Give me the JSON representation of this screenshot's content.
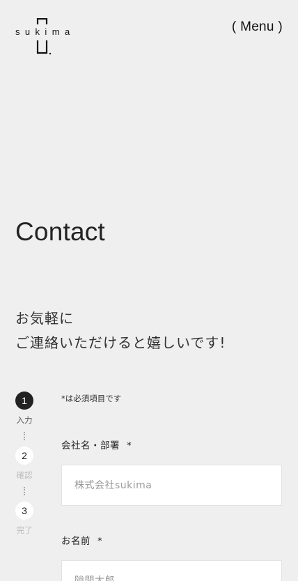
{
  "header": {
    "logo_text": "sukima",
    "menu_label": "( Menu )"
  },
  "page": {
    "title": "Contact",
    "lead_line1": "お気軽に",
    "lead_line2": "ご連絡いただけると嬉しいです!"
  },
  "stepper": {
    "steps": [
      {
        "number": "1",
        "label": "入力",
        "active": true
      },
      {
        "number": "2",
        "label": "確認",
        "active": false
      },
      {
        "number": "3",
        "label": "完了",
        "active": false
      }
    ]
  },
  "form": {
    "required_note": "*は必須項目です",
    "required_mark": "*",
    "company": {
      "label": "会社名・部署",
      "placeholder": "株式会社sukima"
    },
    "name": {
      "label": "お名前",
      "placeholder": "隙間太郎"
    }
  }
}
